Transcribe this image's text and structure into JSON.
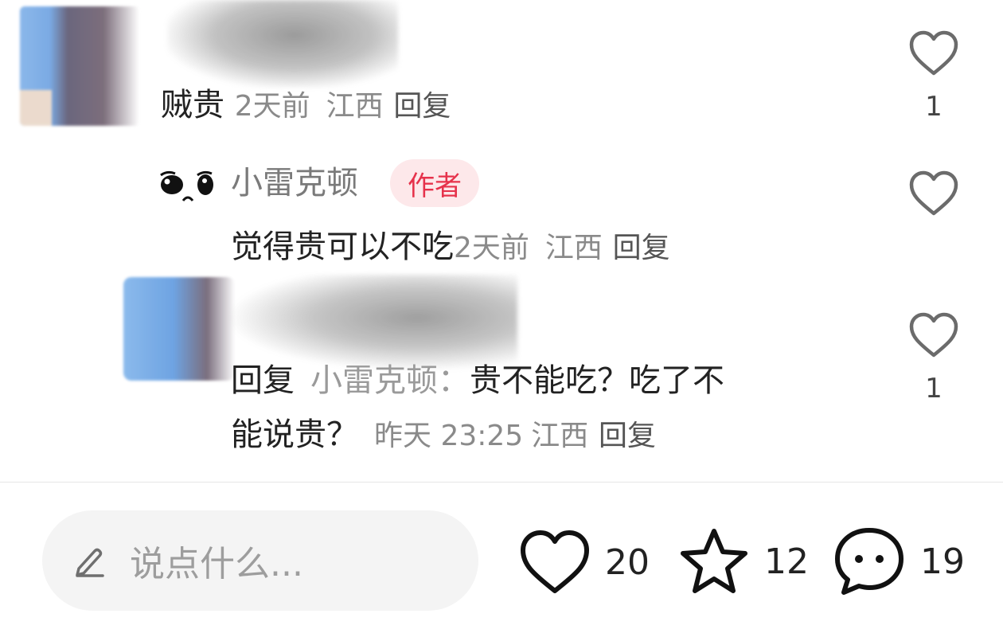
{
  "comments": [
    {
      "text": "贼贵",
      "time": "2天前",
      "location": "江西",
      "reply_label": "回复",
      "like_count": "1"
    },
    {
      "author": "小雷克顿",
      "badge": "作者",
      "text": "觉得贵可以不吃",
      "time": "2天前",
      "location": "江西",
      "reply_label": "回复"
    },
    {
      "reply_prefix": "回复",
      "reply_to": "小雷克顿：",
      "text_line1": "贵不能吃？吃了不",
      "text_line2": "能说贵？",
      "time": "昨天 23:25",
      "location": "江西",
      "reply_label": "回复",
      "like_count": "1"
    }
  ],
  "bottom_bar": {
    "placeholder": "说点什么...",
    "like_count": "20",
    "star_count": "12",
    "comment_count": "19"
  },
  "colors": {
    "badge_bg": "#fde8ea",
    "badge_text": "#e6324b",
    "meta_text": "#8a8a8a"
  }
}
